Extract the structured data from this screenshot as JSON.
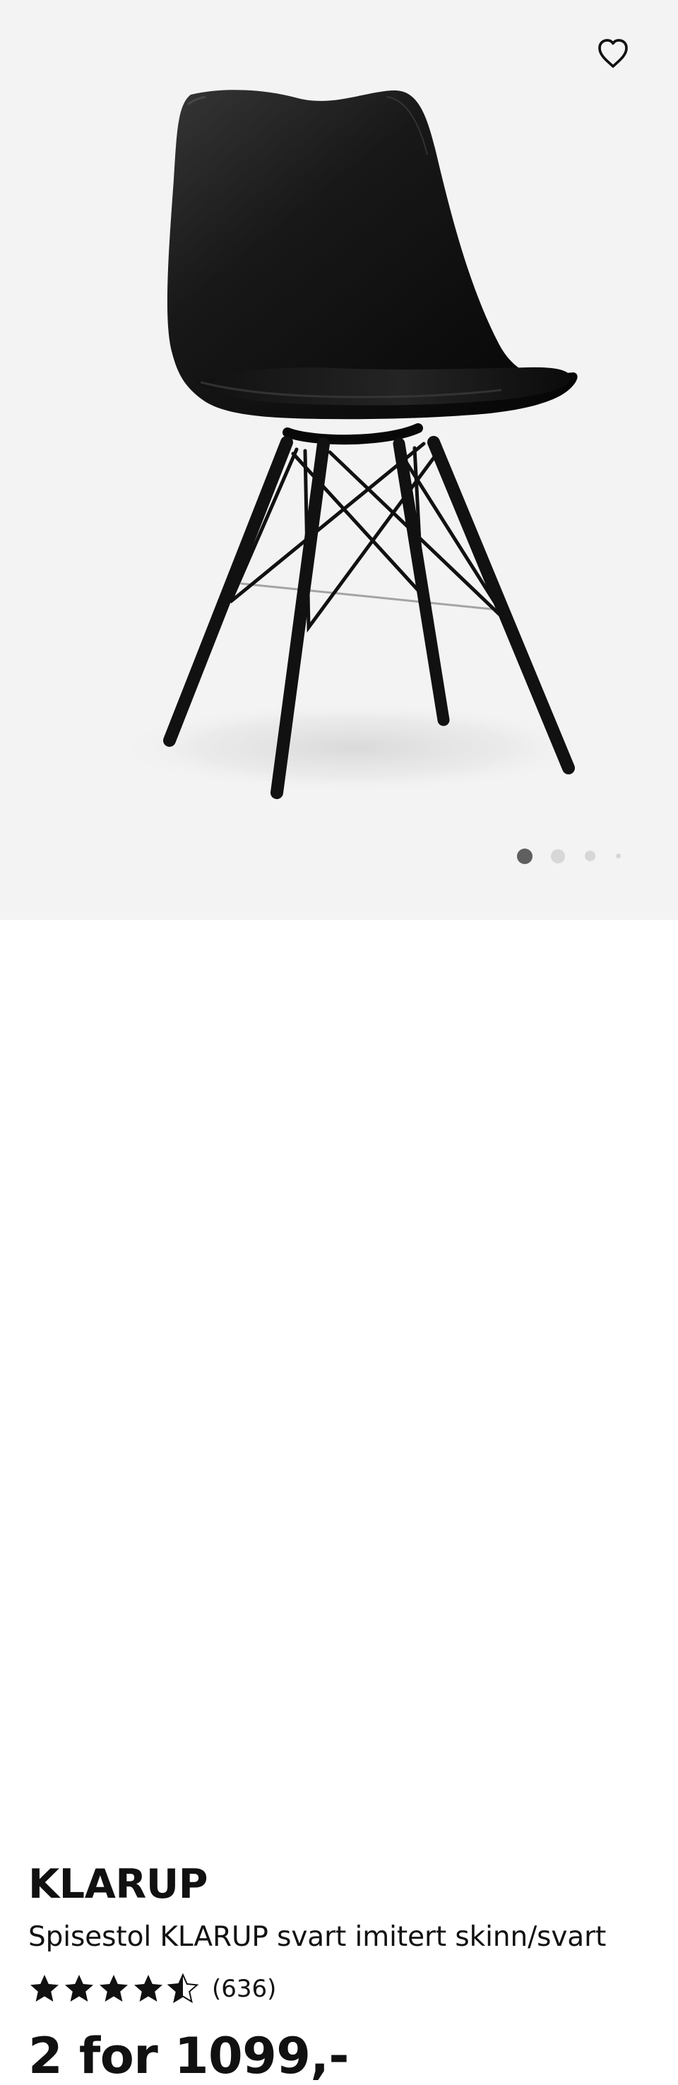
{
  "product": {
    "brand": "KLARUP",
    "description": "Spisestol KLARUP svart imitert skinn/svart",
    "rating": {
      "value": 4.5,
      "max": 5,
      "review_count": "(636)"
    },
    "price": "2 for 1099,-"
  },
  "gallery": {
    "total_images": 4,
    "active_index": 0
  },
  "icons": {
    "favorite": "heart-outline-icon",
    "rating_star": "star-icon"
  },
  "colors": {
    "hero_background": "#f3f3f3",
    "text": "#111111",
    "active_dot": "#5f5f5f",
    "inactive_dot": "#d7d7d7",
    "product": "#151515"
  }
}
